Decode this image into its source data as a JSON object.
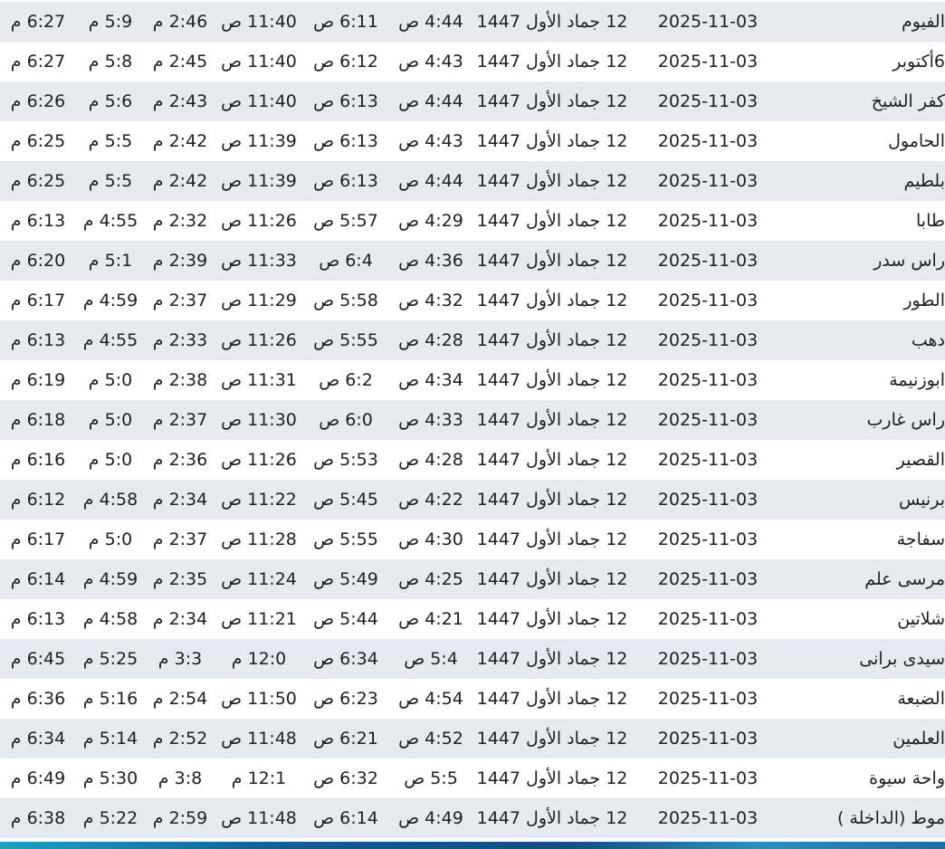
{
  "rows": [
    {
      "city": "الفيوم",
      "gregorian": "2025-11-03",
      "hijri": "12 جماد الأول 1447",
      "fajr": "4:44 ص",
      "sunrise": "6:11 ص",
      "dhuhr": "11:40 ص",
      "asr": "2:46 م",
      "maghrib": "5:9 م",
      "isha": "6:27 م"
    },
    {
      "city": "6أكتوبر",
      "gregorian": "2025-11-03",
      "hijri": "12 جماد الأول 1447",
      "fajr": "4:43 ص",
      "sunrise": "6:12 ص",
      "dhuhr": "11:40 ص",
      "asr": "2:45 م",
      "maghrib": "5:8 م",
      "isha": "6:27 م"
    },
    {
      "city": "كفر الشيخ",
      "gregorian": "2025-11-03",
      "hijri": "12 جماد الأول 1447",
      "fajr": "4:44 ص",
      "sunrise": "6:13 ص",
      "dhuhr": "11:40 ص",
      "asr": "2:43 م",
      "maghrib": "5:6 م",
      "isha": "6:26 م"
    },
    {
      "city": "الحامول",
      "gregorian": "2025-11-03",
      "hijri": "12 جماد الأول 1447",
      "fajr": "4:43 ص",
      "sunrise": "6:13 ص",
      "dhuhr": "11:39 ص",
      "asr": "2:42 م",
      "maghrib": "5:5 م",
      "isha": "6:25 م"
    },
    {
      "city": "بلطيم",
      "gregorian": "2025-11-03",
      "hijri": "12 جماد الأول 1447",
      "fajr": "4:44 ص",
      "sunrise": "6:13 ص",
      "dhuhr": "11:39 ص",
      "asr": "2:42 م",
      "maghrib": "5:5 م",
      "isha": "6:25 م"
    },
    {
      "city": "طابا",
      "gregorian": "2025-11-03",
      "hijri": "12 جماد الأول 1447",
      "fajr": "4:29 ص",
      "sunrise": "5:57 ص",
      "dhuhr": "11:26 ص",
      "asr": "2:32 م",
      "maghrib": "4:55 م",
      "isha": "6:13 م"
    },
    {
      "city": "راس سدر",
      "gregorian": "2025-11-03",
      "hijri": "12 جماد الأول 1447",
      "fajr": "4:36 ص",
      "sunrise": "6:4 ص",
      "dhuhr": "11:33 ص",
      "asr": "2:39 م",
      "maghrib": "5:1 م",
      "isha": "6:20 م"
    },
    {
      "city": "الطور",
      "gregorian": "2025-11-03",
      "hijri": "12 جماد الأول 1447",
      "fajr": "4:32 ص",
      "sunrise": "5:58 ص",
      "dhuhr": "11:29 ص",
      "asr": "2:37 م",
      "maghrib": "4:59 م",
      "isha": "6:17 م"
    },
    {
      "city": "دهب",
      "gregorian": "2025-11-03",
      "hijri": "12 جماد الأول 1447",
      "fajr": "4:28 ص",
      "sunrise": "5:55 ص",
      "dhuhr": "11:26 ص",
      "asr": "2:33 م",
      "maghrib": "4:55 م",
      "isha": "6:13 م"
    },
    {
      "city": "ابوزنيمة",
      "gregorian": "2025-11-03",
      "hijri": "12 جماد الأول 1447",
      "fajr": "4:34 ص",
      "sunrise": "6:2 ص",
      "dhuhr": "11:31 ص",
      "asr": "2:38 م",
      "maghrib": "5:0 م",
      "isha": "6:19 م"
    },
    {
      "city": "راس غارب",
      "gregorian": "2025-11-03",
      "hijri": "12 جماد الأول 1447",
      "fajr": "4:33 ص",
      "sunrise": "6:0 ص",
      "dhuhr": "11:30 ص",
      "asr": "2:37 م",
      "maghrib": "5:0 م",
      "isha": "6:18 م"
    },
    {
      "city": "القصير",
      "gregorian": "2025-11-03",
      "hijri": "12 جماد الأول 1447",
      "fajr": "4:28 ص",
      "sunrise": "5:53 ص",
      "dhuhr": "11:26 ص",
      "asr": "2:36 م",
      "maghrib": "5:0 م",
      "isha": "6:16 م"
    },
    {
      "city": "برنيس",
      "gregorian": "2025-11-03",
      "hijri": "12 جماد الأول 1447",
      "fajr": "4:22 ص",
      "sunrise": "5:45 ص",
      "dhuhr": "11:22 ص",
      "asr": "2:34 م",
      "maghrib": "4:58 م",
      "isha": "6:12 م"
    },
    {
      "city": "سفاجة",
      "gregorian": "2025-11-03",
      "hijri": "12 جماد الأول 1447",
      "fajr": "4:30 ص",
      "sunrise": "5:55 ص",
      "dhuhr": "11:28 ص",
      "asr": "2:37 م",
      "maghrib": "5:0 م",
      "isha": "6:17 م"
    },
    {
      "city": "مرسى علم",
      "gregorian": "2025-11-03",
      "hijri": "12 جماد الأول 1447",
      "fajr": "4:25 ص",
      "sunrise": "5:49 ص",
      "dhuhr": "11:24 ص",
      "asr": "2:35 م",
      "maghrib": "4:59 م",
      "isha": "6:14 م"
    },
    {
      "city": "شلاتين",
      "gregorian": "2025-11-03",
      "hijri": "12 جماد الأول 1447",
      "fajr": "4:21 ص",
      "sunrise": "5:44 ص",
      "dhuhr": "11:21 ص",
      "asr": "2:34 م",
      "maghrib": "4:58 م",
      "isha": "6:13 م"
    },
    {
      "city": "سيدى برانى",
      "gregorian": "2025-11-03",
      "hijri": "12 جماد الأول 1447",
      "fajr": "5:4 ص",
      "sunrise": "6:34 ص",
      "dhuhr": "12:0 م",
      "asr": "3:3 م",
      "maghrib": "5:25 م",
      "isha": "6:45 م"
    },
    {
      "city": "الضبعة",
      "gregorian": "2025-11-03",
      "hijri": "12 جماد الأول 1447",
      "fajr": "4:54 ص",
      "sunrise": "6:23 ص",
      "dhuhr": "11:50 ص",
      "asr": "2:54 م",
      "maghrib": "5:16 م",
      "isha": "6:36 م"
    },
    {
      "city": "العلمين",
      "gregorian": "2025-11-03",
      "hijri": "12 جماد الأول 1447",
      "fajr": "4:52 ص",
      "sunrise": "6:21 ص",
      "dhuhr": "11:48 ص",
      "asr": "2:52 م",
      "maghrib": "5:14 م",
      "isha": "6:34 م"
    },
    {
      "city": "واحة سيوة",
      "gregorian": "2025-11-03",
      "hijri": "12 جماد الأول 1447",
      "fajr": "5:5 ص",
      "sunrise": "6:32 ص",
      "dhuhr": "12:1 م",
      "asr": "3:8 م",
      "maghrib": "5:30 م",
      "isha": "6:49 م"
    },
    {
      "city": "موط (الداخلة )",
      "gregorian": "2025-11-03",
      "hijri": "12 جماد الأول 1447",
      "fajr": "4:49 ص",
      "sunrise": "6:14 ص",
      "dhuhr": "11:48 ص",
      "asr": "2:59 م",
      "maghrib": "5:22 م",
      "isha": "6:38 م"
    }
  ]
}
